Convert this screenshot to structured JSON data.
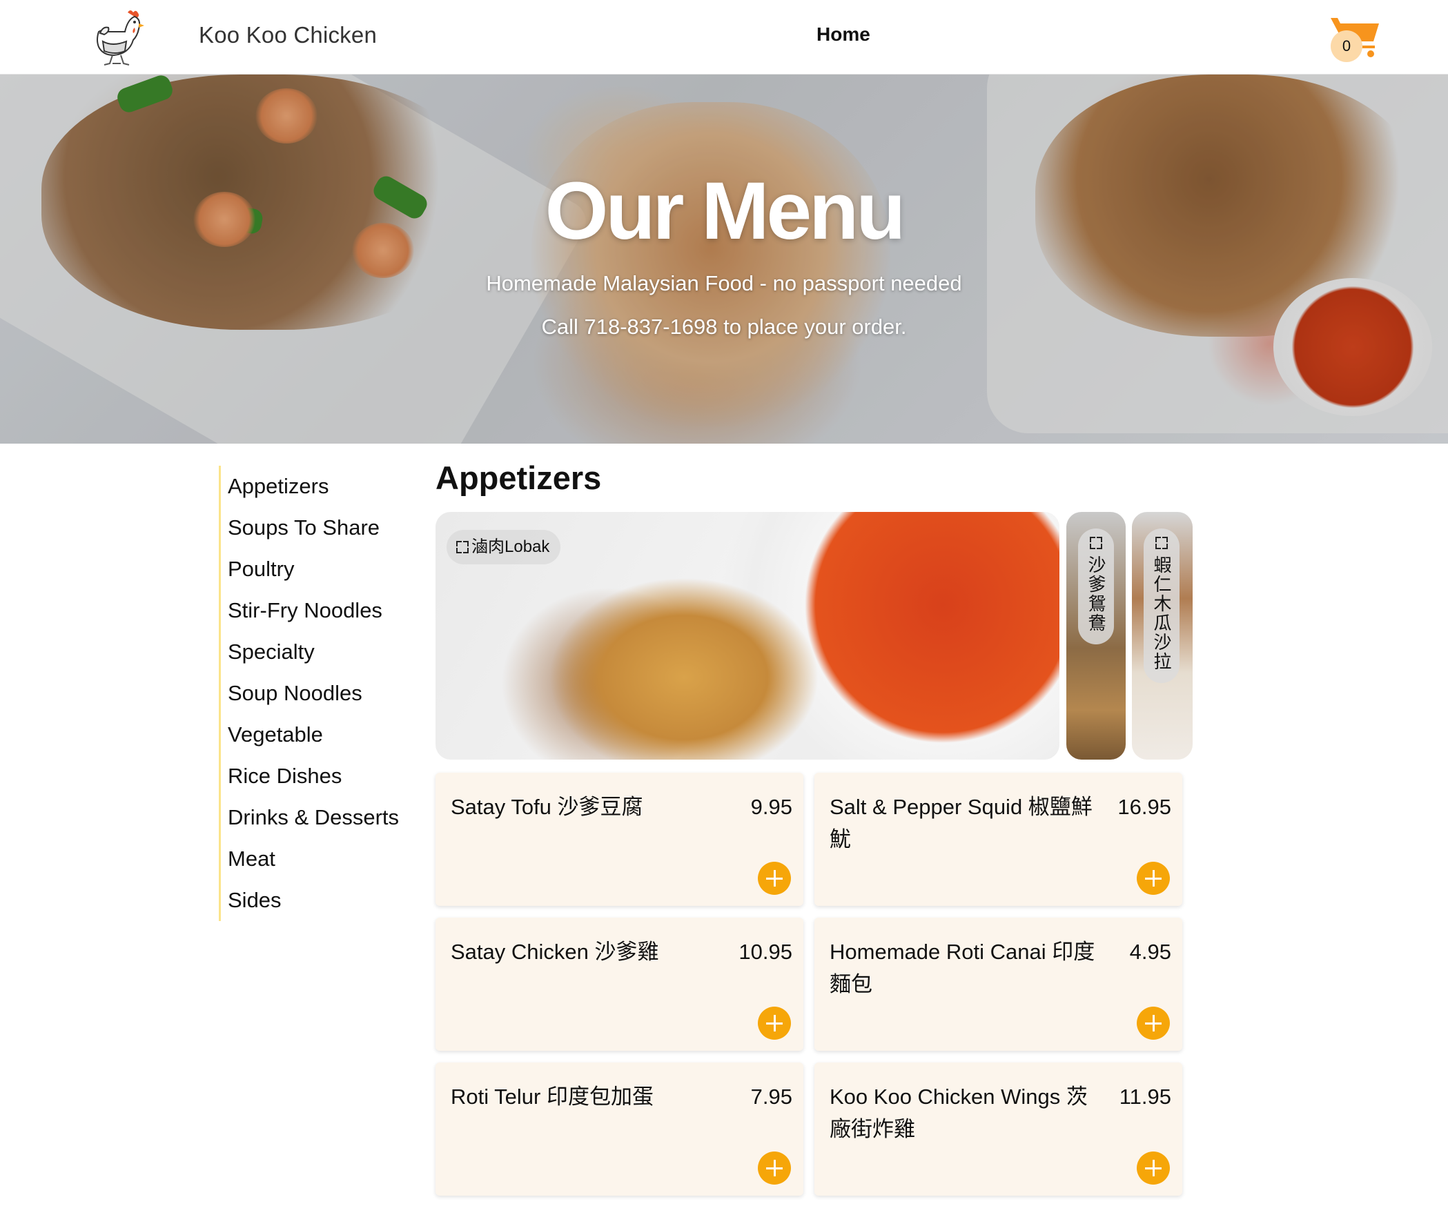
{
  "header": {
    "brand": "Koo Koo Chicken",
    "nav_home": "Home",
    "cart_count": "0",
    "logo_icon": "chicken-logo-icon",
    "cart_icon": "shopping-cart-icon",
    "accent_color": "#f7941d"
  },
  "hero": {
    "title": "Our Menu",
    "subtitle": "Homemade Malaysian Food - no passport needed",
    "call": "Call 718-837-1698 to place your order."
  },
  "sidebar": {
    "items": [
      {
        "label": "Appetizers"
      },
      {
        "label": "Soups To Share"
      },
      {
        "label": "Poultry"
      },
      {
        "label": "Stir-Fry Noodles"
      },
      {
        "label": "Specialty"
      },
      {
        "label": "Soup Noodles"
      },
      {
        "label": "Vegetable"
      },
      {
        "label": "Rice Dishes"
      },
      {
        "label": "Drinks & Desserts"
      },
      {
        "label": "Meat"
      },
      {
        "label": "Sides"
      }
    ],
    "accent_color": "#fbe48a"
  },
  "main": {
    "section_title": "Appetizers",
    "gallery": [
      {
        "label": "滷肉Lobak"
      },
      {
        "label": "沙爹鴛鴦"
      },
      {
        "label": "蝦仁木瓜沙拉"
      }
    ],
    "items": [
      {
        "name": "Satay Tofu 沙爹豆腐",
        "price": "9.95"
      },
      {
        "name": "Salt & Pepper Squid 椒鹽鮮魷",
        "price": "16.95"
      },
      {
        "name": "Satay Chicken 沙爹雞",
        "price": "10.95"
      },
      {
        "name": "Homemade Roti Canai 印度麵包",
        "price": "4.95"
      },
      {
        "name": "Roti Telur 印度包加蛋",
        "price": "7.95"
      },
      {
        "name": "Koo Koo Chicken Wings 茨廠街炸雞",
        "price": "11.95"
      }
    ],
    "card_color": "#fcf5ec",
    "add_button_color": "#f6a609"
  }
}
